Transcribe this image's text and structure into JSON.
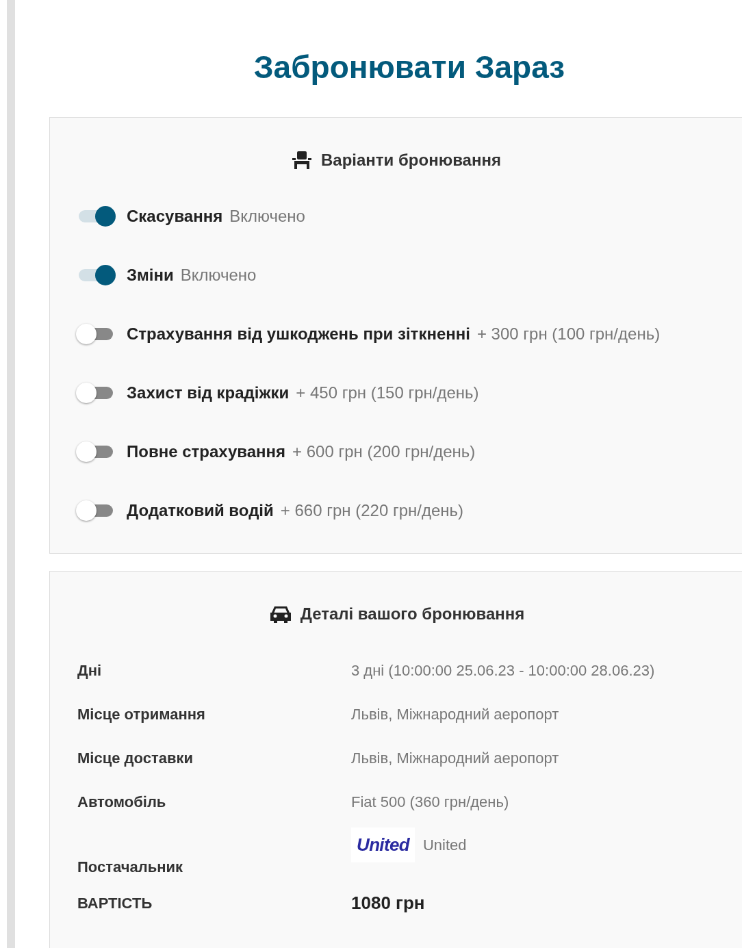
{
  "title": "Забронювати Зараз",
  "options_panel": {
    "heading": "Варіанти бронювання",
    "options": [
      {
        "label": "Скасування",
        "detail": "Включено",
        "on": true
      },
      {
        "label": "Зміни",
        "detail": "Включено",
        "on": true
      },
      {
        "label": "Страхування від ушкоджень при зіткненні",
        "detail": "+ 300 грн (100 грн/день)",
        "on": false
      },
      {
        "label": "Захист від крадіжки",
        "detail": "+ 450 грн (150 грн/день)",
        "on": false
      },
      {
        "label": "Повне страхування",
        "detail": "+ 600 грн (200 грн/день)",
        "on": false
      },
      {
        "label": "Додатковий водій",
        "detail": "+ 660 грн (220 грн/день)",
        "on": false
      }
    ]
  },
  "details_panel": {
    "heading": "Деталі вашого бронювання",
    "rows": [
      {
        "kind": "text",
        "label": "Дні",
        "value": "3 дні (10:00:00 25.06.23 - 10:00:00 28.06.23)"
      },
      {
        "kind": "text",
        "label": "Місце отримання",
        "value": "Львів, Міжнародний аеропорт"
      },
      {
        "kind": "text",
        "label": "Місце доставки",
        "value": "Львів, Міжнародний аеропорт"
      },
      {
        "kind": "text",
        "label": "Автомобіль",
        "value": "Fiat 500 (360 грн/день)"
      },
      {
        "kind": "supplier",
        "label": "Постачальник",
        "logo_text": "United",
        "value": "United"
      },
      {
        "kind": "total",
        "label": "ВАРТІСТЬ",
        "value": "1080 грн"
      }
    ]
  }
}
